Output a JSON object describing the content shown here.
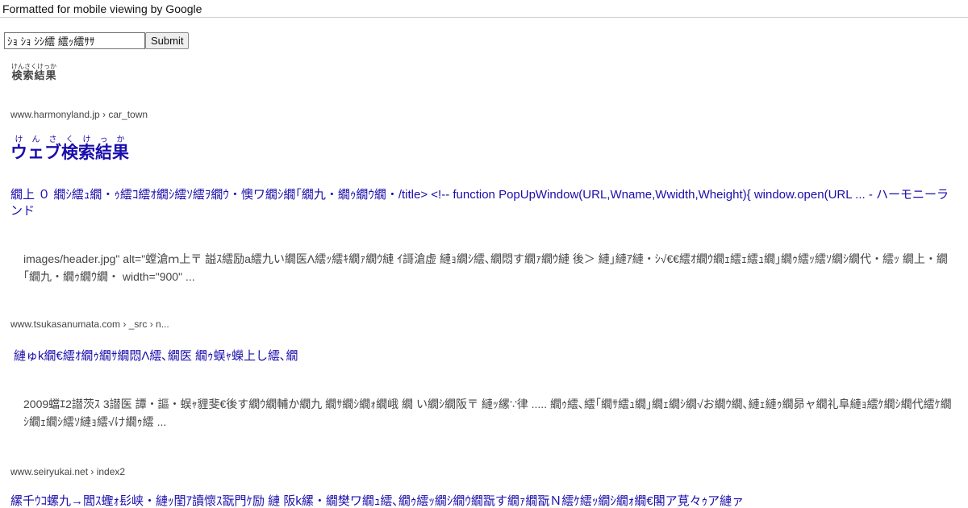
{
  "header": {
    "banner": "Formatted for mobile viewing by Google"
  },
  "search": {
    "value": "ｼｮ ｼｮ ｼｼ繧 繧ｯ繧ｻｻ",
    "submit_label": "Submit"
  },
  "results_section": {
    "title": "検索結果",
    "title_ruby": "けんさくけっか"
  },
  "results": [
    {
      "url": "www.harmonyland.jp › car_town",
      "heading": "ウェブ検索結果",
      "heading_ruby": "けんさくけっか",
      "title": "繝上 ０ 繝ｼ繧ｭ繝・ｩ繧ｺ繧ｵ繝ｼ繧ｿ繧ｦ繝ｳ・懊ワ繝ｼ繝｢繝九・繝ｩ繝ｳ繝・/title> <!-- function PopUpWindow(URL,Wname,Wwidth,Wheight){ window.open(URL ... - ハーモニーランド",
      "snippet": "images/header.jpg\" alt=\"螳滄ｍ上〒 謚ｽ繧励a繧九い繝医Λ繧ｯ繧ｷ繝ｧ繝ｳ縺 ｲ謌滄虚 縺ｮ繝ｼ繧､繝悶す繝ｧ繝ｳ縺 後＞ 縺｣縺ｱ縺・ｼ√€€繧ｵ繝ｳ繝ｪ繧ｪ繧ｭ繝｣繝ｩ繧ｯ繧ｿ繝ｼ繝代・繧ｯ 繝上・繝｢繝九・繝ｩ繝ｳ繝・ width=\"900\" ..."
    },
    {
      "url": "www.tsukasanumata.com › _src › n...",
      "title": "縺ゅk繝€繧ｵ繝ｩ繝ｻ繝悶Λ繧､繝医 繝ｩ蜈ｬ蠑上し繧､繝",
      "snippet": "2009蟷ｴ2譛茨ｽ 3譛医 譚・謳・蜈ｬ貍斐€後す繝ｳ繝輔か繝九 繝ｻ繝ｼ繝ｫ繝峨 繝 い繝ｼ繝阪〒 縺ｯ縲∵律 ..... 繝ｩ繧､繧｢繝ｻ繧ｭ繝｣繝ｪ繝ｼ繝√お繝ｳ繝､縺ｪ縺ｩ繝昴ャ繝礼阜縺ｮ繧ｹ繝ｼ繝代繧ｹ繝ｼ繝ｪ繝ｼ繧ｿ縺ｮ繧√け繝ｩ繧 ..."
    },
    {
      "url": "www.seiryukai.net › index2",
      "title": "縲千ｳｺ螺九→閭ｽ蟶ｫ髟峡・縺ｯ閨ｱ讀懷ｽ翫門ｹ励 縺 阪k縲・繝樊ワ繝ｭ繧､繝ｩ繧ｯ繝ｼ繝ｳ繝翫す繝ｧ繝翫Ｎ繧ｹ繧ｯ繝ｼ繝ｫ繝€閣ア莧々ｩア縺ァ"
    }
  ]
}
